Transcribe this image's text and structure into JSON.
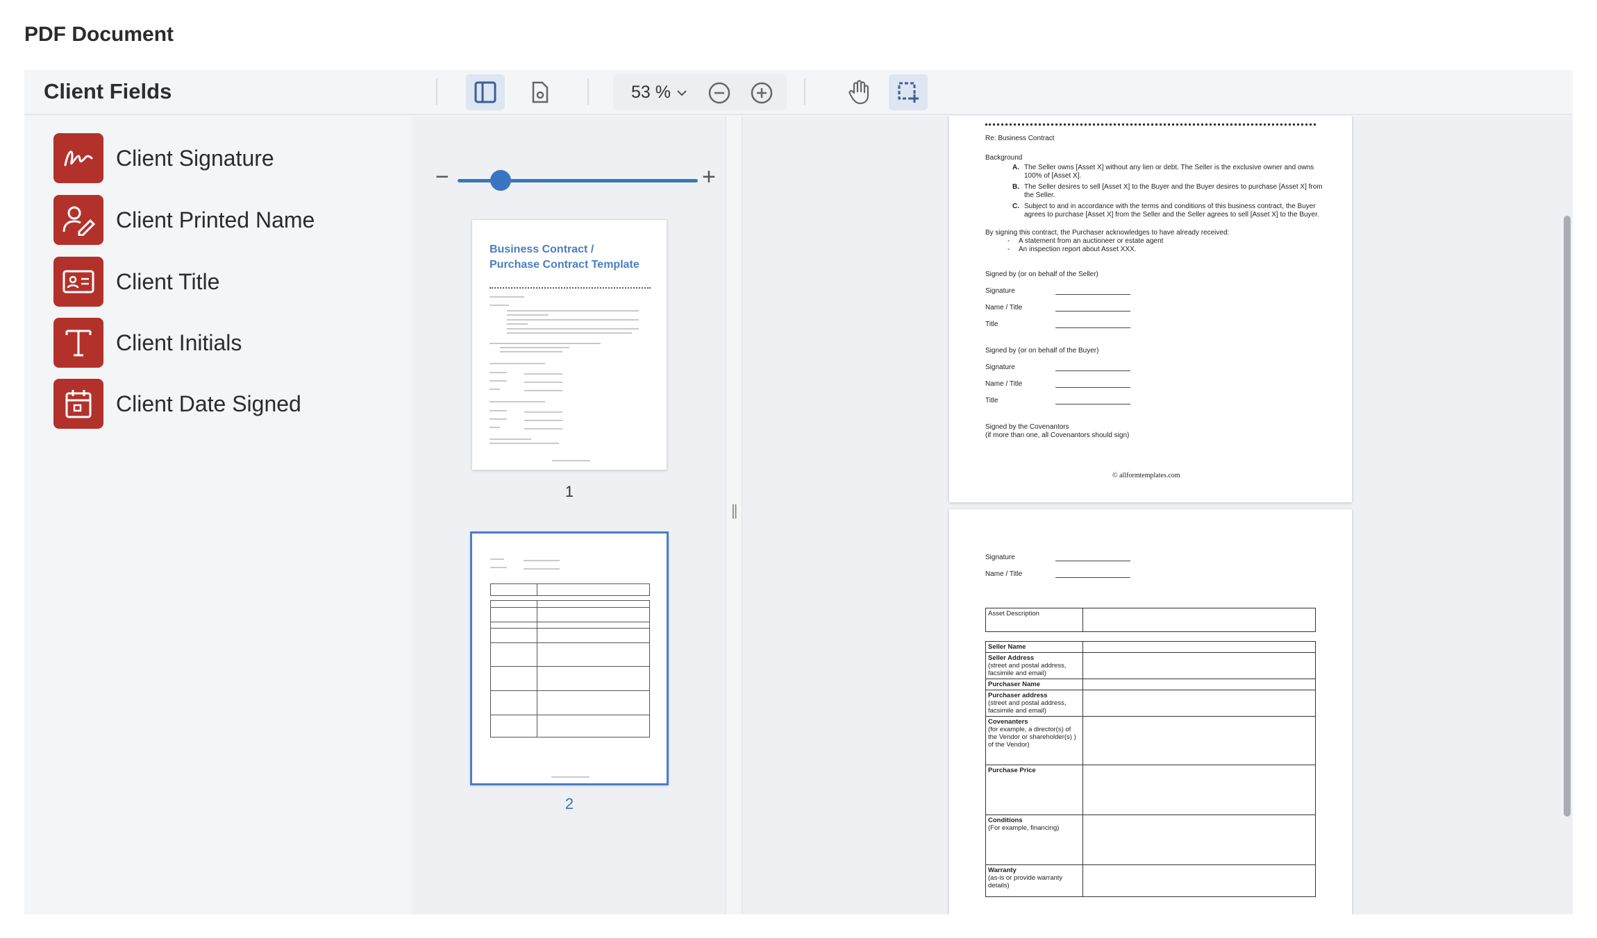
{
  "page_title": "PDF Document",
  "toolbar": {
    "fields_heading": "Client Fields",
    "zoom_value": "53 %"
  },
  "fields": [
    {
      "label": "Client Signature",
      "icon": "signature-icon"
    },
    {
      "label": "Client Printed Name",
      "icon": "user-edit-icon"
    },
    {
      "label": "Client Title",
      "icon": "id-card-icon"
    },
    {
      "label": "Client Initials",
      "icon": "text-t-icon"
    },
    {
      "label": "Client Date Signed",
      "icon": "calendar-icon"
    }
  ],
  "accent_color": "#b3312b",
  "thumbnails": {
    "zoom_slider_level": 0.15,
    "pages": [
      {
        "number": "1",
        "title_line1": "Business Contract /",
        "title_line2": "Purchase Contract Template"
      },
      {
        "number": "2"
      }
    ]
  },
  "document": {
    "page1": {
      "re": "Re: Business Contract",
      "background": "Background",
      "items": [
        {
          "marker": "A.",
          "text1": "The Seller owns [Asset X] without any lien or debt. The Seller is the exclusive owner and owns",
          "text2": "100% of [Asset X]."
        },
        {
          "marker": "B.",
          "text1": "The Seller desires to sell [Asset X] to the Buyer and the Buyer desires to purchase [Asset X] from",
          "text2": "the Seller."
        },
        {
          "marker": "C.",
          "text1": "Subject to and in accordance with the terms and conditions of this business contract, the Buyer",
          "text2": "agrees to purchase [Asset X] from the Seller and the Seller agrees to sell [Asset X] to the Buyer."
        }
      ],
      "ack": "By signing this contract, the Purchaser acknowledges to have already received:",
      "bullets": [
        "A statement from an auctioneer or estate agent",
        "An inspection report about Asset XXX."
      ],
      "seller_block": "Signed by (or on behalf of the Seller)",
      "buyer_block": "Signed by (or on behalf of the Buyer)",
      "sig_label": "Signature",
      "name_label": "Name / Title",
      "title_label": "Title",
      "covenantors": "Signed by the Covenantors",
      "covenantors_note": "(if more than one, all Covenantors should sign)",
      "footer": "© allformtemplates.com"
    },
    "page2": {
      "sig_label": "Signature",
      "name_label": "Name / Title",
      "asset_description": "Asset Description",
      "rows": [
        {
          "key": "Seller Name",
          "sub": ""
        },
        {
          "key": "Seller Address",
          "sub": "(street and postal address, facsimile and email)"
        },
        {
          "key": "Purchaser Name",
          "sub": ""
        },
        {
          "key": "Purchaser address",
          "sub": "(street and postal address, facsimile and email)"
        },
        {
          "key": "Covenanters",
          "sub": "(for example, a director(s) of the Vendor or shareholder(s) ) of the Vendor)"
        },
        {
          "key": "Purchase Price",
          "sub": ""
        },
        {
          "key": "Conditions",
          "sub": "(For example, financing)"
        },
        {
          "key": "Warranty",
          "sub": "(as-is or provide warranty details)"
        }
      ]
    }
  }
}
